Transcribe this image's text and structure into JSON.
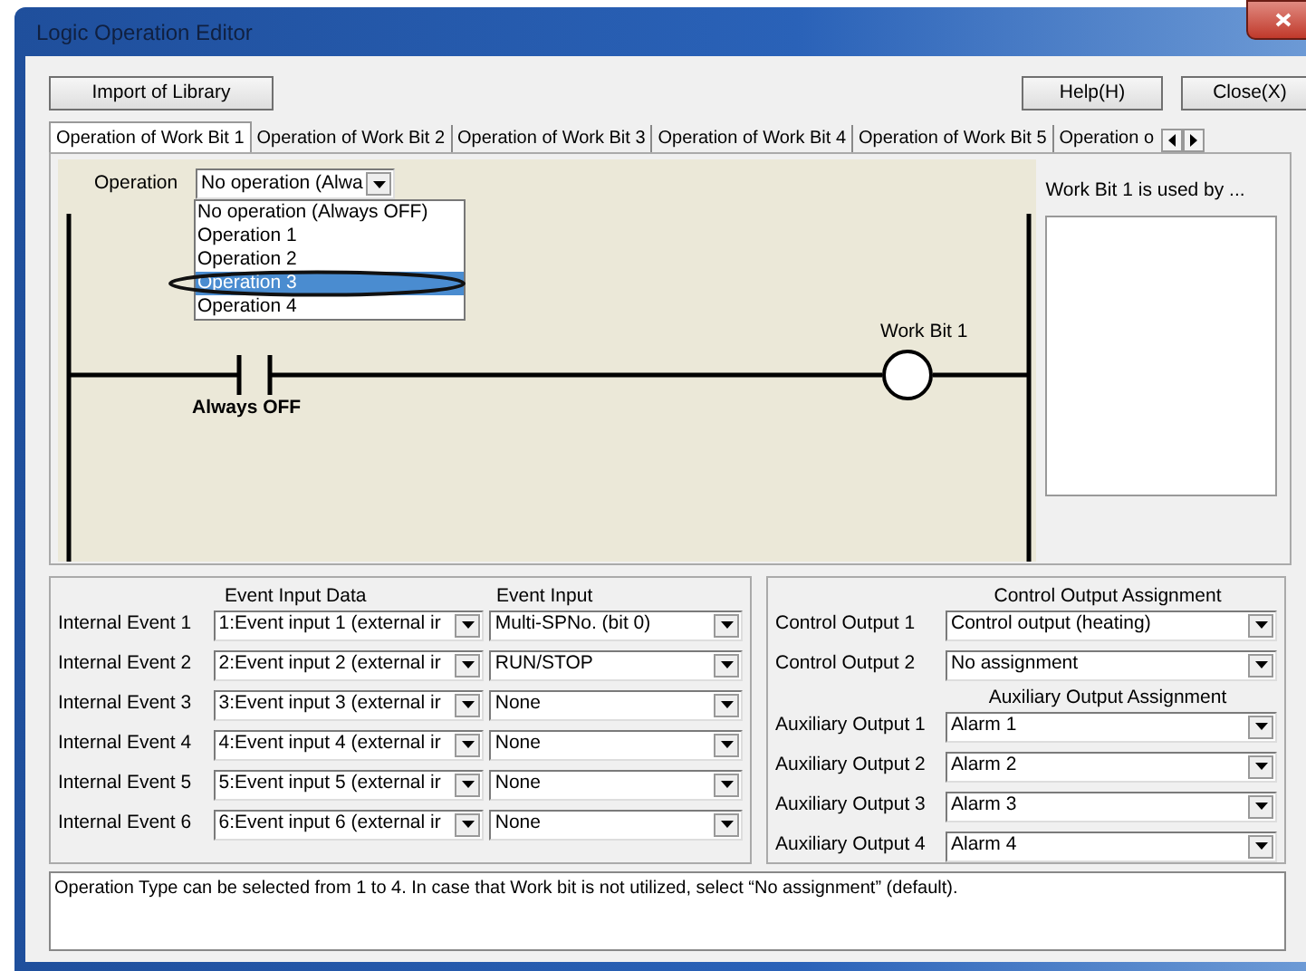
{
  "window": {
    "title": "Logic Operation Editor"
  },
  "toolbar": {
    "left_buttons": [
      "Import of Library"
    ],
    "right_buttons": [
      "Help(H)",
      "Close(X)"
    ]
  },
  "tabs": [
    {
      "label": "Operation of Work Bit 1",
      "selected": true
    },
    {
      "label": "Operation of Work Bit 2",
      "selected": false
    },
    {
      "label": "Operation of Work Bit 3",
      "selected": false
    },
    {
      "label": "Operation of Work Bit 4",
      "selected": false
    },
    {
      "label": "Operation of Work Bit 5",
      "selected": false
    },
    {
      "label": "Operation o",
      "selected": false
    }
  ],
  "operation": {
    "label": "Operation",
    "value": "No operation (Alwa",
    "expanded": true,
    "options": [
      {
        "label": "No operation (Always OFF)",
        "selected": false
      },
      {
        "label": "Operation 1",
        "selected": false
      },
      {
        "label": "Operation 2",
        "selected": false
      },
      {
        "label": "Operation 3",
        "selected": true
      },
      {
        "label": "Operation 4",
        "selected": false
      }
    ]
  },
  "ladder": {
    "contact_label": "Always OFF",
    "coil_label": "Work Bit 1"
  },
  "usage_panel": {
    "label": "Work Bit 1 is used by ..."
  },
  "event_inputs": {
    "headers": [
      "Event Input Data",
      "Event Input"
    ],
    "rows": [
      {
        "label": "Internal Event 1",
        "data": "1:Event input 1 (external ir",
        "input": "Multi-SPNo. (bit 0)"
      },
      {
        "label": "Internal Event 2",
        "data": "2:Event input 2 (external ir",
        "input": "RUN/STOP"
      },
      {
        "label": "Internal Event 3",
        "data": "3:Event input 3 (external ir",
        "input": "None"
      },
      {
        "label": "Internal Event 4",
        "data": "4:Event input 4 (external ir",
        "input": "None"
      },
      {
        "label": "Internal Event 5",
        "data": "5:Event input 5 (external ir",
        "input": "None"
      },
      {
        "label": "Internal Event 6",
        "data": "6:Event input 6 (external ir",
        "input": "None"
      }
    ]
  },
  "outputs": {
    "control_header": "Control Output Assignment",
    "control": [
      {
        "label": "Control Output 1",
        "value": "Control output (heating)"
      },
      {
        "label": "Control Output 2",
        "value": "No assignment"
      }
    ],
    "auxiliary_header": "Auxiliary Output Assignment",
    "auxiliary": [
      {
        "label": "Auxiliary Output 1",
        "value": "Alarm 1"
      },
      {
        "label": "Auxiliary Output 2",
        "value": "Alarm 2"
      },
      {
        "label": "Auxiliary Output 3",
        "value": "Alarm 3"
      },
      {
        "label": "Auxiliary Output 4",
        "value": "Alarm 4"
      }
    ]
  },
  "description": "Operation Type can be selected from 1 to 4. In case that Work bit is not utilized, select “No assignment” (default)."
}
